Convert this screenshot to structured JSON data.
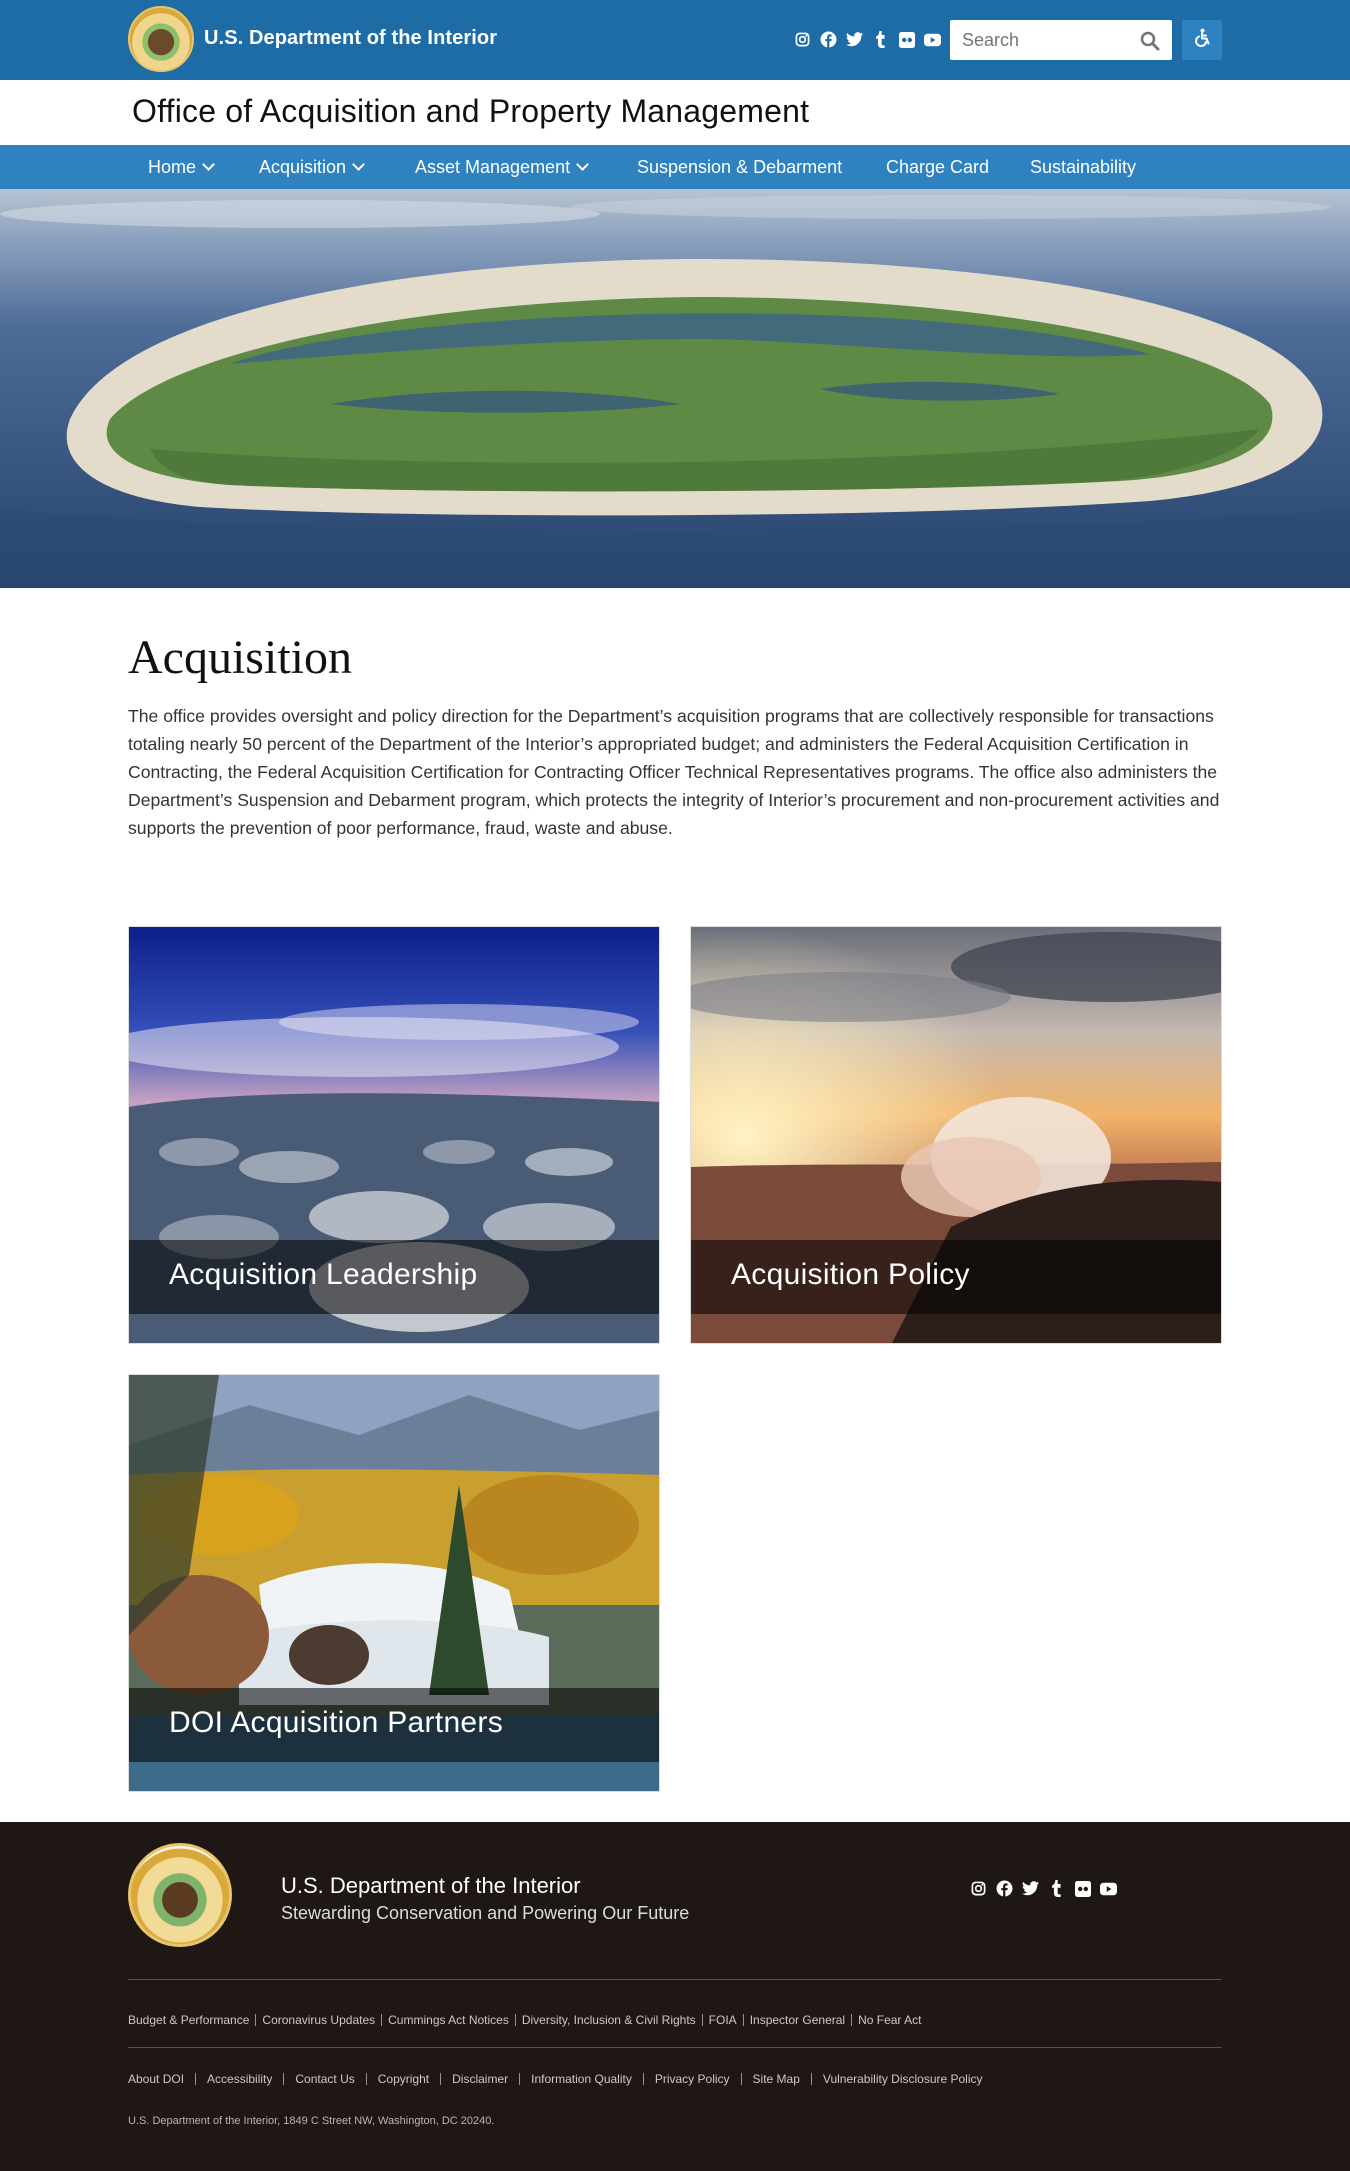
{
  "header": {
    "agency_title": "U.S. Department of the Interior",
    "search_placeholder": "Search",
    "social_icons": [
      "instagram-icon",
      "facebook-icon",
      "twitter-icon",
      "tumblr-icon",
      "flickr-icon",
      "youtube-icon"
    ]
  },
  "office_title": "Office of Acquisition and Property Management",
  "nav": {
    "items": [
      {
        "label": "Home",
        "has_dropdown": true
      },
      {
        "label": "Acquisition",
        "has_dropdown": true
      },
      {
        "label": "Asset Management",
        "has_dropdown": true
      },
      {
        "label": "Suspension & Debarment",
        "has_dropdown": false
      },
      {
        "label": "Charge Card",
        "has_dropdown": false
      },
      {
        "label": "Sustainability",
        "has_dropdown": false
      }
    ]
  },
  "main": {
    "heading": "Acquisition",
    "intro": "The office provides oversight and policy direction for the Department’s acquisition programs that are collectively responsible for transactions totaling nearly 50 percent of the Department of the Interior’s appropriated budget; and administers the Federal Acquisition Certification in Contracting, the Federal Acquisition Certification for Contracting Officer Technical Representatives programs. The office also administers the Department’s Suspension and Debarment program, which protects the integrity of Interior’s procurement and non-procurement activities and supports the prevention of poor performance, fraud, waste and abuse.",
    "cards": [
      {
        "label": "Acquisition Leadership"
      },
      {
        "label": "Acquisition Policy"
      },
      {
        "label": "DOI Acquisition Partners"
      }
    ]
  },
  "footer": {
    "org": "U.S. Department of the Interior",
    "tagline": "Stewarding Conservation and Powering Our Future",
    "links_primary": [
      "Budget & Performance",
      "Coronavirus Updates",
      "Cummings Act Notices",
      "Diversity, Inclusion & Civil Rights",
      "FOIA",
      "Inspector General",
      "No Fear Act"
    ],
    "links_secondary": [
      "About DOI",
      "Accessibility",
      "Contact Us",
      "Copyright",
      "Disclaimer",
      "Information Quality",
      "Privacy Policy",
      "Site Map",
      "Vulnerability Disclosure Policy"
    ],
    "address": "U.S. Department of the Interior, 1849 C Street NW, Washington, DC 20240."
  },
  "colors": {
    "top_bar": "#1d6ca6",
    "nav_bar": "#2e82c0",
    "footer": "#1e1714"
  }
}
